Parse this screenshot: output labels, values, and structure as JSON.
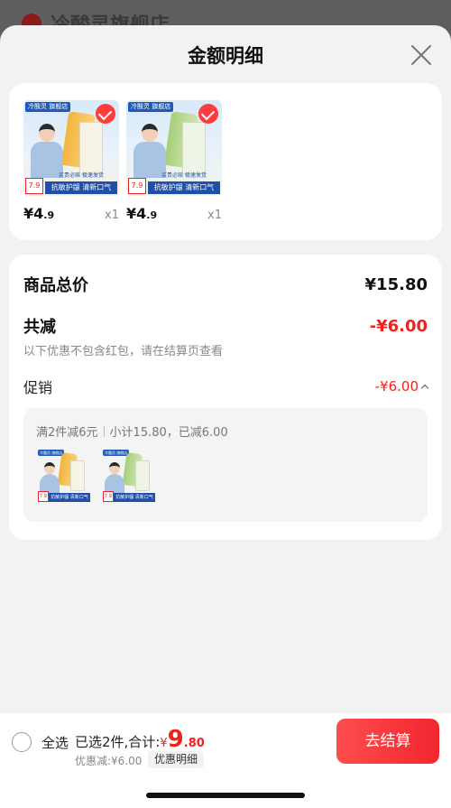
{
  "backdrop": {
    "store_name": "冷酸灵旗舰店"
  },
  "sheet": {
    "title": "金额明细"
  },
  "products": [
    {
      "variant": "orange",
      "price_int": "¥4",
      "price_dec": ".9",
      "qty": "x1",
      "img_logo": "冷酸灵 旗舰店",
      "img_price": "7.9",
      "img_banner": "抗敏护龈 清新口气",
      "img_sub": "买贵必赔 极速发货"
    },
    {
      "variant": "green",
      "price_int": "¥4",
      "price_dec": ".9",
      "qty": "x1",
      "img_logo": "冷酸灵 旗舰店",
      "img_price": "7.9",
      "img_banner": "抗敏护龈 清新口气",
      "img_sub": "买贵必赔 极速发货"
    }
  ],
  "summary": {
    "total_label": "商品总价",
    "total_value": "¥15.80",
    "reduce_label": "共减",
    "reduce_value": "-¥6.00",
    "note": "以下优惠不包含红包，请在结算页查看",
    "promo_label": "促销",
    "promo_value": "-¥6.00",
    "promo_rule": "满2件减6元",
    "promo_detail": "小计15.80，已减6.00"
  },
  "bottom_bar": {
    "select_all": "全选",
    "selected_text": "已选2件,合计:",
    "total_yen": "¥",
    "total_int": "9",
    "total_dec": ".80",
    "discount_text": "优惠减:¥6.00",
    "detail_chip": "优惠明细",
    "checkout_label": "去结算"
  },
  "colors": {
    "accent_red": "#f0221f",
    "checkout_gradient_start": "#ff4d4d",
    "checkout_gradient_end": "#f2262e"
  }
}
